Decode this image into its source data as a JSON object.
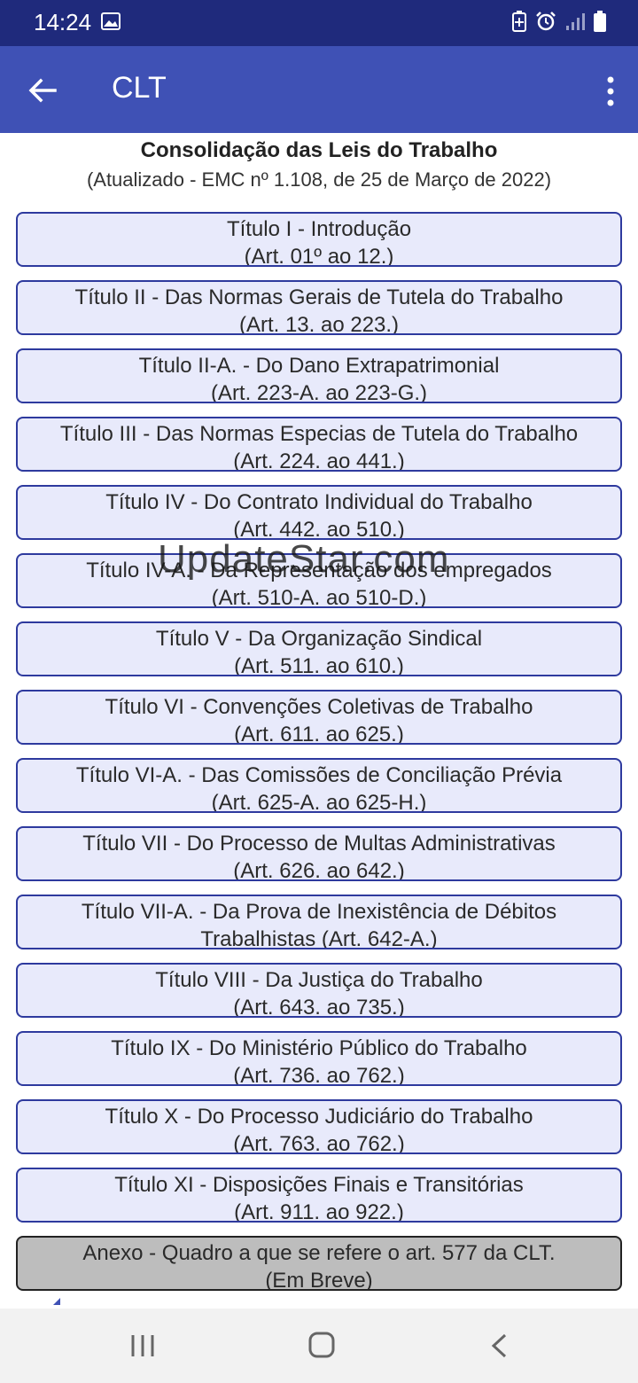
{
  "status_bar": {
    "time": "14:24",
    "icons": [
      "image-icon",
      "battery-saver-icon",
      "alarm-icon",
      "signal-icon",
      "battery-icon"
    ]
  },
  "app_bar": {
    "title": "CLT",
    "back_icon": "arrow-left-icon",
    "menu_icon": "more-vert-icon"
  },
  "header": {
    "title": "Consolidação das Leis do Trabalho",
    "subtitle": "(Atualizado - EMC nº 1.108, de 25 de Março de 2022)"
  },
  "titles": [
    {
      "line1": "Título I - Introdução",
      "line2": "(Art. 01º ao 12.)"
    },
    {
      "line1": "Título II - Das Normas Gerais de Tutela do Trabalho",
      "line2": "(Art. 13. ao 223.)"
    },
    {
      "line1": "Título II-A. - Do Dano Extrapatrimonial",
      "line2": "(Art. 223-A. ao 223-G.)"
    },
    {
      "line1": "Título III - Das Normas Especias de Tutela do Trabalho",
      "line2": "(Art. 224. ao 441.)"
    },
    {
      "line1": "Título IV - Do Contrato Individual do Trabalho",
      "line2": "(Art. 442. ao 510.)"
    },
    {
      "line1": "Título IV-A. - Da Representação dos empregados",
      "line2": "(Art. 510-A. ao 510-D.)"
    },
    {
      "line1": "Título V - Da Organização Sindical",
      "line2": "(Art. 511. ao 610.)"
    },
    {
      "line1": "Título VI - Convenções Coletivas de Trabalho",
      "line2": "(Art. 611. ao 625.)"
    },
    {
      "line1": "Título VI-A. - Das Comissões de Conciliação Prévia",
      "line2": "(Art. 625-A. ao 625-H.)"
    },
    {
      "line1": "Título VII - Do Processo de Multas Administrativas",
      "line2": "(Art. 626. ao 642.)"
    },
    {
      "line1": "Título VII-A. - Da Prova de Inexistência de Débitos",
      "line2": "Trabalhistas (Art. 642-A.)"
    },
    {
      "line1": "Título VIII - Da Justiça do Trabalho",
      "line2": "(Art. 643. ao 735.)"
    },
    {
      "line1": "Título IX - Do Ministério Público do Trabalho",
      "line2": "(Art. 736. ao 762.)"
    },
    {
      "line1": "Título X - Do Processo Judiciário do Trabalho",
      "line2": "(Art. 763. ao 762.)"
    },
    {
      "line1": "Título XI - Disposições Finais e Transitórias",
      "line2": "(Art. 911. ao 922.)"
    }
  ],
  "annex": {
    "line1": "Anexo - Quadro a que se refere o art. 577 da CLT.",
    "line2": "(Em Breve)"
  },
  "watermark": "UpdateStar.com",
  "nav_bar": {
    "icons": [
      "recents-icon",
      "home-icon",
      "back-icon"
    ]
  },
  "colors": {
    "app_bar": "#3f51b5",
    "status_bar": "#1f2a7c",
    "button_bg": "#e8eafb",
    "button_border": "#2e3a9e",
    "annex_bg": "#bdbdbd"
  }
}
